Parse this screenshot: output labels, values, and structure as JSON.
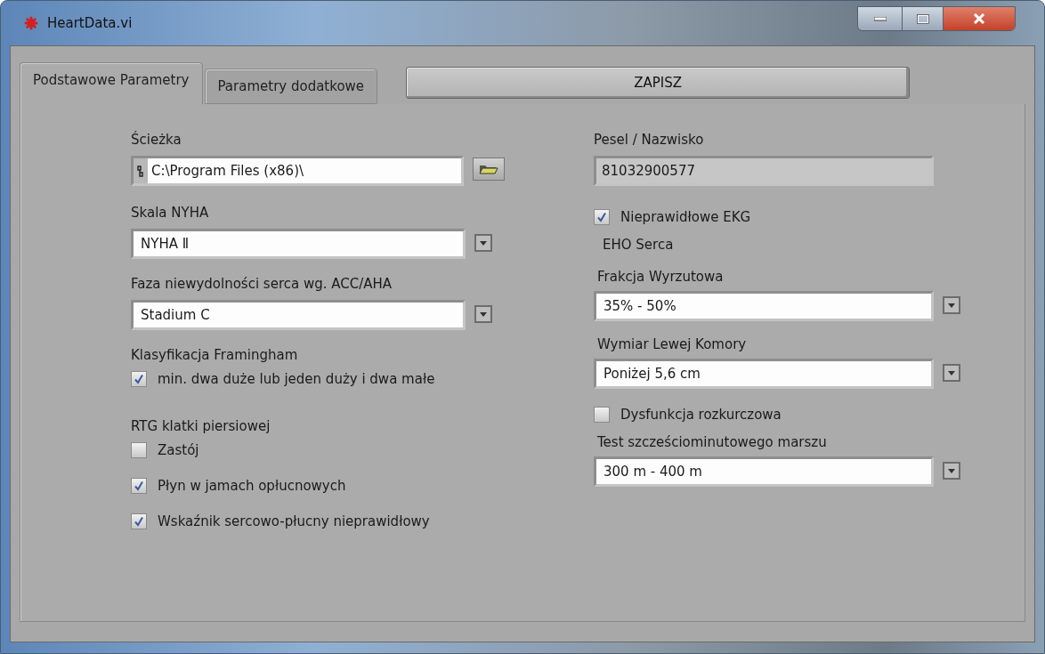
{
  "window": {
    "title": "HeartData.vi"
  },
  "tabs": [
    {
      "label": "Podstawowe Parametry",
      "selected": true
    },
    {
      "label": "Parametry dodatkowe",
      "selected": false
    }
  ],
  "save_button": "ZAPISZ",
  "left_column": [
    {
      "kind": "path",
      "label": "Ścieżka",
      "value": "C:\\Program Files (x86)\\"
    },
    {
      "kind": "dropdown",
      "label": "Skala NYHA",
      "value": "NYHA Ⅱ"
    },
    {
      "kind": "dropdown",
      "label": "Faza niewydolności serca wg. ACC/AHA",
      "value": "Stadium C"
    },
    {
      "kind": "checkgroup",
      "label": "Klasyfikacja Framingham",
      "items": [
        {
          "label": "min. dwa duże lub jeden duży i dwa małe",
          "checked": true
        }
      ]
    },
    {
      "kind": "checkgroup",
      "label": "RTG klatki piersiowej",
      "items": [
        {
          "label": "Zastój",
          "checked": false
        },
        {
          "label": "Płyn w jamach opłucnowych",
          "checked": true
        },
        {
          "label": "Wskaźnik sercowo-płucny nieprawidłowy",
          "checked": true
        }
      ]
    }
  ],
  "right_column": [
    {
      "kind": "text",
      "label": "Pesel / Nazwisko",
      "value": "81032900577",
      "disabled": true
    },
    {
      "kind": "checkbox",
      "label": "Nieprawidłowe EKG",
      "checked": true
    },
    {
      "kind": "heading",
      "label": "EHO Serca"
    },
    {
      "kind": "dropdown",
      "label": "Frakcja Wyrzutowa",
      "value": "35% - 50%"
    },
    {
      "kind": "dropdown",
      "label": "Wymiar Lewej Komory",
      "value": "Poniżej 5,6 cm"
    },
    {
      "kind": "checkbox",
      "label": "Dysfunkcja rozkurczowa",
      "checked": false
    },
    {
      "kind": "dropdown",
      "label": "Test szcześciominutowego marszu",
      "value": "300 m - 400 m"
    }
  ]
}
